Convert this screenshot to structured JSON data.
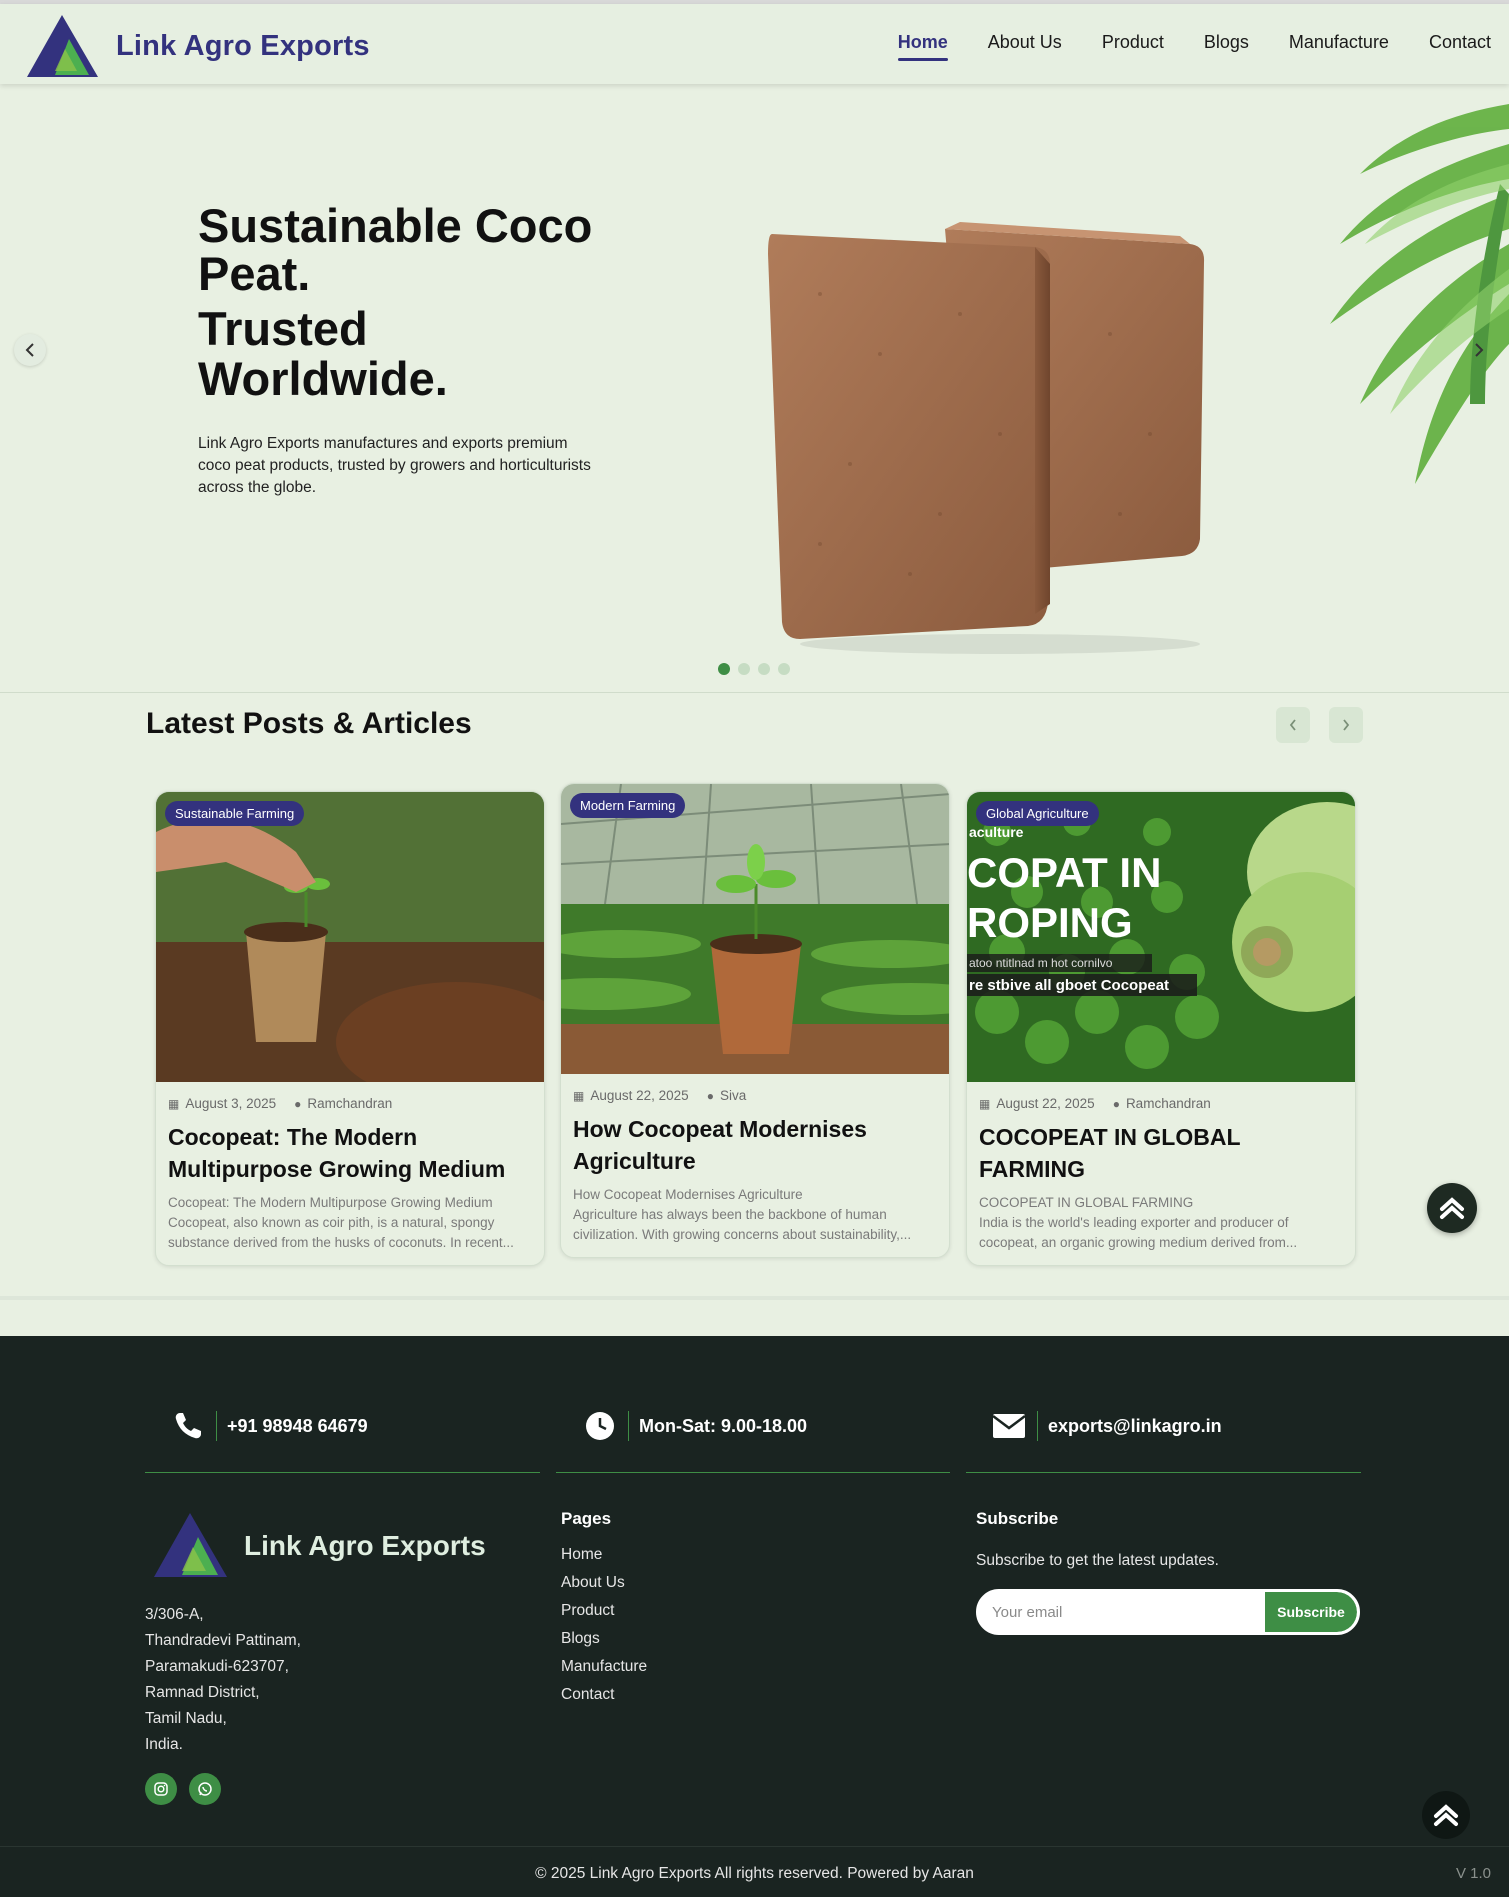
{
  "brand": {
    "name": "Link Agro Exports"
  },
  "nav": {
    "items": [
      {
        "label": "Home",
        "active": true
      },
      {
        "label": "About Us"
      },
      {
        "label": "Product"
      },
      {
        "label": "Blogs"
      },
      {
        "label": "Manufacture"
      },
      {
        "label": "Contact"
      }
    ]
  },
  "hero": {
    "title": "Sustainable Coco Peat.",
    "subtitle": "Trusted Worldwide.",
    "description": "Link Agro Exports manufactures and exports premium coco peat products, trusted by growers and horticulturists across the globe.",
    "prev_icon": "chevron-left-icon",
    "next_icon": "chevron-right-icon",
    "slides": 4,
    "active_slide": 1
  },
  "posts": {
    "heading": "Latest Posts & Articles",
    "items": [
      {
        "tag": "Sustainable Farming",
        "date": "August 3, 2025",
        "author": "Ramchandran",
        "title": "Cocopeat: The Modern Multipurpose Growing Medium",
        "excerpt_1": "Cocopeat: The Modern Multipurpose Growing Medium",
        "excerpt_2": "Cocopeat, also known as coir pith, is a natural, spongy",
        "excerpt_3": "substance derived from the husks of coconuts. In recent..."
      },
      {
        "tag": "Modern Farming",
        "date": "August 22, 2025",
        "author": "Siva",
        "title": "How Cocopeat Modernises Agriculture",
        "excerpt_1": "How Cocopeat Modernises Agriculture",
        "excerpt_2": "Agriculture has always been the backbone of human",
        "excerpt_3": "civilization. With growing concerns about sustainability,..."
      },
      {
        "tag": "Global Agriculture",
        "date": "August 22, 2025",
        "author": "Ramchandran",
        "title": "COCOPEAT IN GLOBAL FARMING",
        "excerpt_1": "COCOPEAT IN GLOBAL FARMING",
        "excerpt_2": "India is the world's leading exporter and producer of",
        "excerpt_3": "cocopeat, an organic growing medium derived from...",
        "image_text_1": "aculture",
        "image_text_2": "COPAT IN",
        "image_text_3": "ROPING",
        "image_text_4": "atoo ntitlnad m hot cornilvo",
        "image_text_5": "re stbive all gboet Cocopeat"
      }
    ]
  },
  "footer": {
    "phone": "+91 98948 64679",
    "hours": "Mon-Sat: 9.00-18.00",
    "email": "exports@linkagro.in",
    "brand": "Link Agro Exports",
    "address": [
      "3/306-A,",
      "Thandradevi Pattinam,",
      "Paramakudi-623707,",
      "Ramnad District,",
      "Tamil Nadu,",
      "India."
    ],
    "pages_heading": "Pages",
    "pages": [
      "Home",
      "About Us",
      "Product",
      "Blogs",
      "Manufacture",
      "Contact"
    ],
    "subscribe_heading": "Subscribe",
    "subscribe_desc": "Subscribe to get the latest updates.",
    "subscribe_placeholder": "Your email",
    "subscribe_button": "Subscribe",
    "copyright": "© 2025 Link Agro Exports All rights reserved. Powered by Aaran",
    "version": "V 1.0"
  },
  "colors": {
    "brand": "#33327e",
    "accent": "#3e8e45",
    "footer_bg": "#1a2421",
    "page_bg": "#e8f0e2"
  },
  "icons": [
    "phone-icon",
    "clock-icon",
    "envelope-icon",
    "instagram-icon",
    "whatsapp-icon",
    "calendar-icon",
    "user-icon",
    "double-chevron-up-icon"
  ]
}
